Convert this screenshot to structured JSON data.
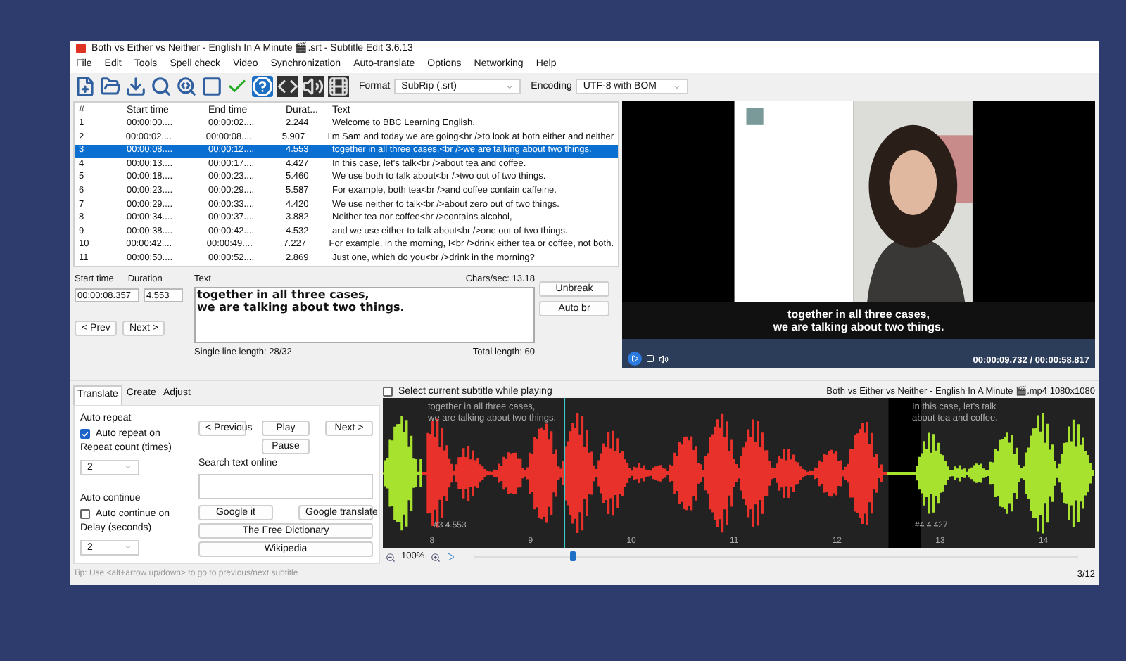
{
  "window": {
    "title": "Both vs Either vs Neither - English In A Minute 🎬.srt - Subtitle Edit 3.6.13"
  },
  "menu": [
    "File",
    "Edit",
    "Tools",
    "Spell check",
    "Video",
    "Synchronization",
    "Auto-translate",
    "Options",
    "Networking",
    "Help"
  ],
  "toolbar": {
    "format_label": "Format",
    "format_value": "SubRip (.srt)",
    "encoding_label": "Encoding",
    "encoding_value": "UTF-8 with BOM"
  },
  "table": {
    "columns": [
      "#",
      "Start time",
      "End time",
      "Durat...",
      "Text"
    ],
    "rows": [
      {
        "cells": [
          "1",
          "00:00:00....",
          "00:00:02....",
          "2.244",
          "Welcome to BBC Learning English."
        ],
        "selected": false
      },
      {
        "cells": [
          "2",
          "00:00:02....",
          "00:00:08....",
          "5.907",
          "I'm Sam and today we are going<br />to look at both either and neither"
        ],
        "selected": false
      },
      {
        "cells": [
          "3",
          "00:00:08....",
          "00:00:12....",
          "4.553",
          "together in all three cases,<br />we are talking about two things."
        ],
        "selected": true
      },
      {
        "cells": [
          "4",
          "00:00:13....",
          "00:00:17....",
          "4.427",
          "In this case, let's talk<br />about tea and coffee."
        ],
        "selected": false
      },
      {
        "cells": [
          "5",
          "00:00:18....",
          "00:00:23....",
          "5.460",
          "We use both to talk about<br />two out of two things."
        ],
        "selected": false
      },
      {
        "cells": [
          "6",
          "00:00:23....",
          "00:00:29....",
          "5.587",
          "For example, both tea<br />and coffee contain caffeine."
        ],
        "selected": false
      },
      {
        "cells": [
          "7",
          "00:00:29....",
          "00:00:33....",
          "4.420",
          "We use neither to talk<br />about zero out of two things."
        ],
        "selected": false
      },
      {
        "cells": [
          "8",
          "00:00:34....",
          "00:00:37....",
          "3.882",
          "Neither tea nor coffee<br />contains alcohol,"
        ],
        "selected": false
      },
      {
        "cells": [
          "9",
          "00:00:38....",
          "00:00:42....",
          "4.532",
          "and we use either to talk about<br />one out of two things."
        ],
        "selected": false
      },
      {
        "cells": [
          "10",
          "00:00:42....",
          "00:00:49....",
          "7.227",
          "For example, in the morning, I<br />drink either tea or coffee, not both."
        ],
        "selected": false
      },
      {
        "cells": [
          "11",
          "00:00:50....",
          "00:00:52....",
          "2.869",
          "Just one, which do you<br />drink in the morning?"
        ],
        "selected": false
      }
    ]
  },
  "editor": {
    "start_time_label": "Start time",
    "start_time": "00:00:08.357",
    "duration_label": "Duration",
    "duration": "4.553",
    "text_label": "Text",
    "chars_sec": "Chars/sec: 13.18",
    "text_lines": [
      "together in all three cases,",
      "we are talking about two things."
    ],
    "single_line_length": "Single line length: 28/32",
    "total_length": "Total length: 60",
    "prev": "< Prev",
    "next": "Next >",
    "unbreak": "Unbreak",
    "auto_br": "Auto br"
  },
  "video": {
    "subtitle_lines": [
      "together in all three cases,",
      "we are talking about two things."
    ],
    "time": "00:00:09.732 / 00:00:58.817"
  },
  "tabs": [
    {
      "label": "Translate",
      "selected": true
    },
    {
      "label": "Create",
      "selected": false
    },
    {
      "label": "Adjust",
      "selected": false
    }
  ],
  "auto_repeat": {
    "title": "Auto repeat",
    "checkbox": {
      "label": "Auto repeat on",
      "checked": true
    },
    "count_label": "Repeat count (times)",
    "count_value": "2"
  },
  "auto_continue": {
    "title": "Auto continue",
    "checkbox": {
      "label": "Auto continue on",
      "checked": false
    },
    "delay_label": "Delay (seconds)",
    "delay_value": "2"
  },
  "playback_buttons": [
    "< Previous",
    "Play",
    "Next >",
    "Pause"
  ],
  "search_online": {
    "label": "Search text online",
    "buttons": [
      "Google it",
      "Google translate",
      "The Free Dictionary",
      "Wikipedia"
    ]
  },
  "tip": "Tip: Use <alt+arrow up/down> to go to previous/next subtitle",
  "waveform": {
    "checkbox": {
      "label": "Select current subtitle while playing",
      "checked": false
    },
    "file_info": "Both vs Either vs Neither - English In A Minute 🎬.mp4 1080x1080",
    "overlays": [
      {
        "lines": [
          "together in all three cases,",
          "we are talking about two things."
        ],
        "number": "#3  4.553"
      },
      {
        "lines": [
          "In this case, let's talk",
          "about tea and coffee."
        ],
        "number": "#4  4.427"
      }
    ],
    "ticks": [
      "8",
      "9",
      "10",
      "11",
      "12",
      "13",
      "14"
    ],
    "zoom": "100%",
    "position": {
      "level": 0.16
    }
  },
  "status": "3/12"
}
